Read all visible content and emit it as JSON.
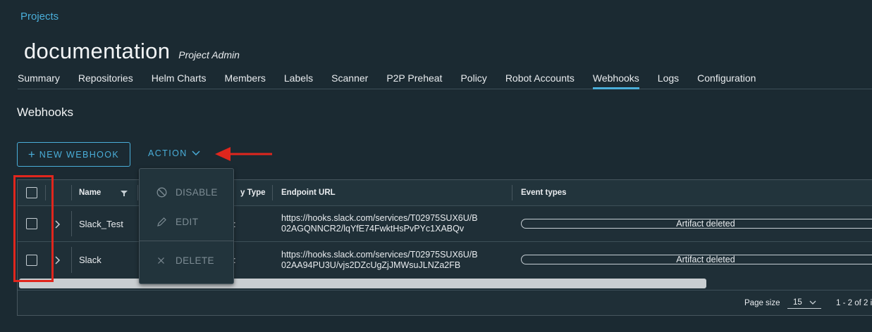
{
  "breadcrumb": "Projects",
  "project": {
    "name": "documentation",
    "role": "Project Admin"
  },
  "tabs": [
    {
      "label": "Summary"
    },
    {
      "label": "Repositories"
    },
    {
      "label": "Helm Charts"
    },
    {
      "label": "Members"
    },
    {
      "label": "Labels"
    },
    {
      "label": "Scanner"
    },
    {
      "label": "P2P Preheat"
    },
    {
      "label": "Policy"
    },
    {
      "label": "Robot Accounts"
    },
    {
      "label": "Webhooks"
    },
    {
      "label": "Logs"
    },
    {
      "label": "Configuration"
    }
  ],
  "active_tab": "Webhooks",
  "section_title": "Webhooks",
  "toolbar": {
    "new_label": "NEW WEBHOOK",
    "action_label": "ACTION"
  },
  "action_menu": {
    "disable": "DISABLE",
    "edit": "EDIT",
    "delete": "DELETE"
  },
  "table": {
    "headers": {
      "name": "Name",
      "notify_type": "y Type",
      "endpoint": "Endpoint URL",
      "events": "Event types"
    },
    "rows": [
      {
        "name": "Slack_Test",
        "notify_type": ":",
        "url_line1": "https://hooks.slack.com/services/T02975SUX6U/B",
        "url_line2": "02AGQNNCR2/lqYfE74FwktHsPvPYc1XABQv",
        "event": "Artifact deleted"
      },
      {
        "name": "Slack",
        "notify_type": ":",
        "url_line1": "https://hooks.slack.com/services/T02975SUX6U/B",
        "url_line2": "02AA94PU3U/vjs2DZcUgZjJMWsuJLNZa2FB",
        "event": "Artifact deleted"
      }
    ]
  },
  "footer": {
    "page_size_label": "Page size",
    "page_size_value": "15",
    "range": "1 - 2 of 2 i"
  },
  "colors": {
    "accent": "#4aaed9",
    "annotation": "#e0261d",
    "background": "#1b2a32"
  }
}
